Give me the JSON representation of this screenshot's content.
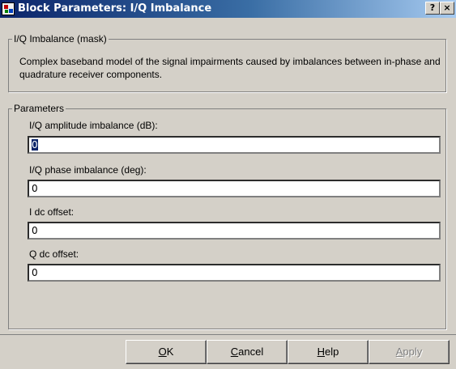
{
  "window": {
    "title": "Block Parameters: I/Q Imbalance",
    "help_button": "?",
    "close_button": "×"
  },
  "mask": {
    "legend": "I/Q Imbalance (mask)",
    "description": "Complex baseband model of the signal impairments caused by imbalances between in-phase and quadrature receiver components."
  },
  "parameters": {
    "legend": "Parameters",
    "amplitude_label": "I/Q amplitude imbalance (dB):",
    "amplitude_value": "0",
    "phase_label": "I/Q phase imbalance (deg):",
    "phase_value": "0",
    "i_dc_label": "I dc offset:",
    "i_dc_value": "0",
    "q_dc_label": "Q dc offset:",
    "q_dc_value": "0"
  },
  "buttons": {
    "ok_mnemonic": "O",
    "ok_rest": "K",
    "cancel_mnemonic": "C",
    "cancel_rest": "ancel",
    "help_mnemonic": "H",
    "help_rest": "elp",
    "apply_mnemonic": "A",
    "apply_rest": "pply"
  },
  "icons": {
    "app": "simulink-block-icon",
    "help": "help-icon",
    "close": "close-icon"
  }
}
